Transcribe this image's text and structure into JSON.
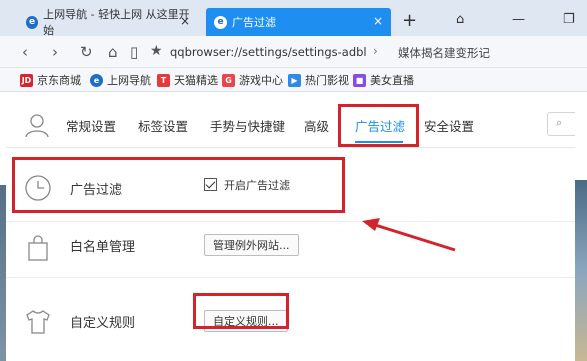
{
  "browser": {
    "tabs": [
      {
        "label": "上网导航 - 轻快上网 从这里开始",
        "active": false
      },
      {
        "label": "广告过滤",
        "active": true
      }
    ],
    "new_tab": "+",
    "address": "qqbrowser://settings/settings-adblc",
    "search_hint": "媒体揭名建变形记"
  },
  "bookmarks": [
    {
      "label": "京东商城",
      "icon": "jd-icon",
      "color": "#d9232d",
      "glyph": "JD"
    },
    {
      "label": "上网导航",
      "icon": "ie-icon",
      "color": "#1b6fc7",
      "glyph": "e"
    },
    {
      "label": "天猫精选",
      "icon": "tmall-icon",
      "color": "#e43a3a",
      "glyph": "T"
    },
    {
      "label": "游戏中心",
      "icon": "gamepad-icon",
      "color": "#e9464c",
      "glyph": "G"
    },
    {
      "label": "热门影视",
      "icon": "play-icon",
      "color": "#2e8ae6",
      "glyph": "▶"
    },
    {
      "label": "美女直播",
      "icon": "video-icon",
      "color": "#8a4be0",
      "glyph": "■"
    }
  ],
  "settings_nav": [
    {
      "label": "常规设置"
    },
    {
      "label": "标签设置"
    },
    {
      "label": "手势与快捷键"
    },
    {
      "label": "高级"
    },
    {
      "label": "广告过滤",
      "active": true
    },
    {
      "label": "安全设置"
    }
  ],
  "sections": {
    "ad_filter": {
      "title": "广告过滤",
      "checkbox_label": "开启广告过滤",
      "checked": true
    },
    "whitelist": {
      "title": "白名单管理",
      "button": "管理例外网站..."
    },
    "custom_rules": {
      "title": "自定义规则",
      "button": "自定义规则..."
    }
  },
  "colors": {
    "accent": "#1e8ef0",
    "annotation": "#d3242b"
  }
}
